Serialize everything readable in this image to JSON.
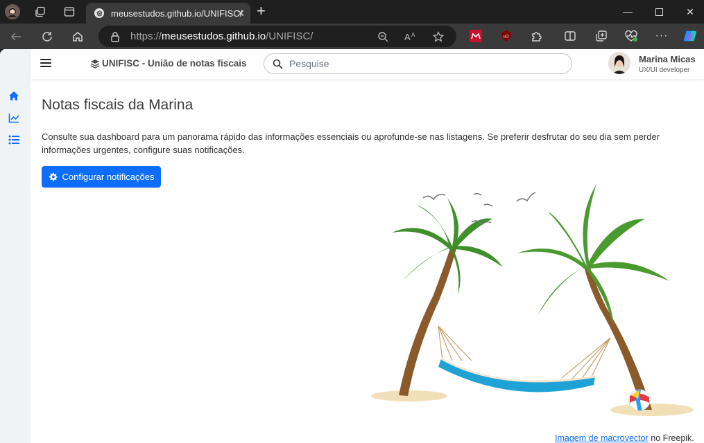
{
  "browser": {
    "tab_title": "meusestudos.github.io/UNIFISC/",
    "url_scheme": "https://",
    "url_host": "meusestudos.github.io",
    "url_path": "/UNIFISC/"
  },
  "header": {
    "brand": "UNIFISC - União de notas fiscais",
    "search_placeholder": "Pesquise",
    "user_name": "Marina Micas",
    "user_role": "UX/UI developer"
  },
  "sidebar": {
    "items": [
      {
        "icon": "home-icon"
      },
      {
        "icon": "chart-line-icon"
      },
      {
        "icon": "list-icon"
      }
    ]
  },
  "main": {
    "title": "Notas fiscais da Marina",
    "intro": "Consulte sua dashboard para um panorama rápido das informações essenciais ou aprofunde-se nas listagens. Se preferir desfrutar do seu dia sem perder informações urgentes, configure suas notificações.",
    "config_button": "Configurar notificações",
    "credit_link": "Imagem de macrovector",
    "credit_suffix": " no Freepik."
  },
  "colors": {
    "accent": "#0d6efd",
    "browser_dark": "#1f1f1f",
    "browser_toolbar": "#3a3a3a"
  }
}
